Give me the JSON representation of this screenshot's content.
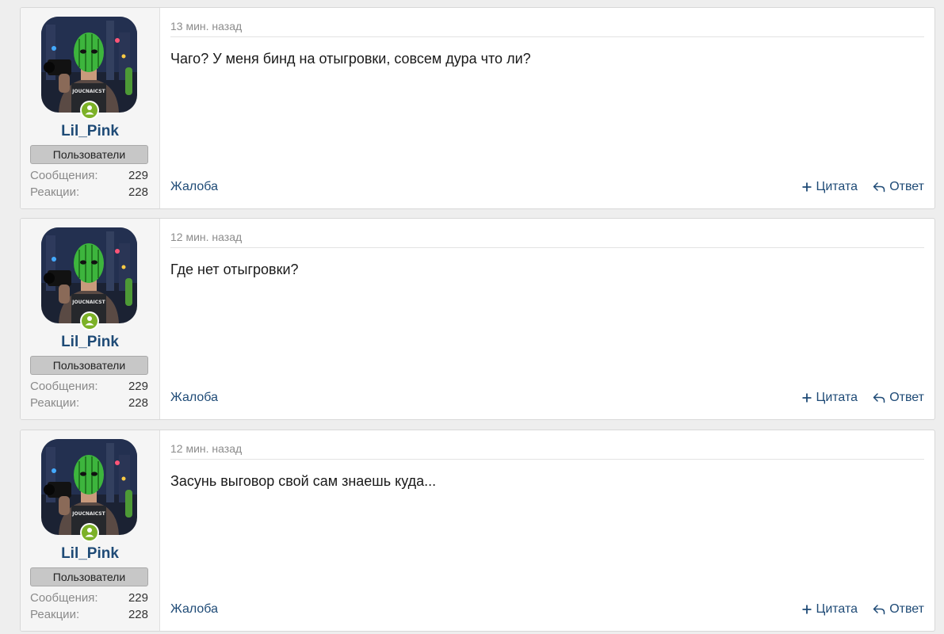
{
  "posts": [
    {
      "author": "Lil_Pink",
      "avatar_badge": "JOUCNAICST",
      "group": "Пользователи",
      "stats": [
        {
          "label": "Сообщения:",
          "value": "229"
        },
        {
          "label": "Реакции:",
          "value": "228"
        }
      ],
      "time": "13 мин. назад",
      "message": "Чаго? У меня бинд на отыгровки, совсем дура что ли?",
      "actions": {
        "report": "Жалоба",
        "quote": "Цитата",
        "reply": "Ответ"
      }
    },
    {
      "author": "Lil_Pink",
      "avatar_badge": "JOUCNAICST",
      "group": "Пользователи",
      "stats": [
        {
          "label": "Сообщения:",
          "value": "229"
        },
        {
          "label": "Реакции:",
          "value": "228"
        }
      ],
      "time": "12 мин. назад",
      "message": "Где нет отыгровки?",
      "actions": {
        "report": "Жалоба",
        "quote": "Цитата",
        "reply": "Ответ"
      }
    },
    {
      "author": "Lil_Pink",
      "avatar_badge": "JOUCNAICST",
      "group": "Пользователи",
      "stats": [
        {
          "label": "Сообщения:",
          "value": "229"
        },
        {
          "label": "Реакции:",
          "value": "228"
        }
      ],
      "time": "12 мин. назад",
      "message": "Засунь выговор свой сам знаешь куда...",
      "actions": {
        "report": "Жалоба",
        "quote": "Цитата",
        "reply": "Ответ"
      }
    }
  ],
  "icons": {
    "online_status": "person-icon",
    "quote": "plus-icon",
    "reply": "reply-arrow-icon"
  },
  "colors": {
    "link": "#1e4a76",
    "online": "#7cb127",
    "background": "#eeeeee"
  }
}
